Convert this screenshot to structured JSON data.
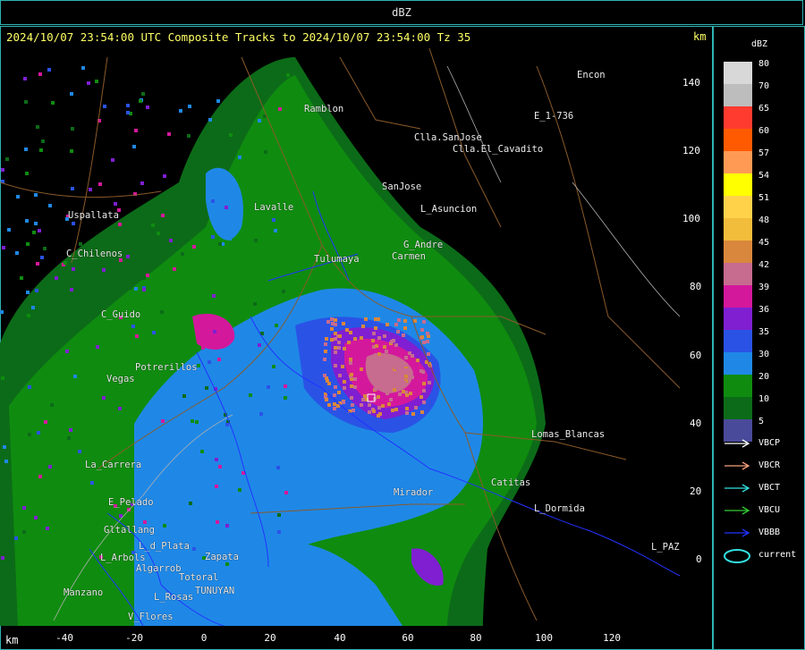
{
  "window": {
    "title": "dBZ"
  },
  "header": {
    "text": "2024/10/07 23:54:00 UTC Composite Tracks to 2024/10/07 23:54:00 Tz 35",
    "km_label": "km"
  },
  "axes": {
    "x_unit": "km",
    "x_ticks": [
      "-40",
      "-20",
      "0",
      "20",
      "40",
      "60",
      "80",
      "100",
      "120"
    ],
    "y_ticks": [
      "140",
      "120",
      "100",
      "80",
      "60",
      "40",
      "20",
      "0"
    ]
  },
  "legend": {
    "title": "dBZ",
    "levels": [
      {
        "label": "80",
        "color": "#d8d8d8"
      },
      {
        "label": "70",
        "color": "#bdbdbd"
      },
      {
        "label": "65",
        "color": "#ff3b2f"
      },
      {
        "label": "60",
        "color": "#ff5a00"
      },
      {
        "label": "57",
        "color": "#ff9a55"
      },
      {
        "label": "54",
        "color": "#ffff00"
      },
      {
        "label": "51",
        "color": "#ffd24a"
      },
      {
        "label": "48",
        "color": "#f2bd3a"
      },
      {
        "label": "45",
        "color": "#d9873c"
      },
      {
        "label": "42",
        "color": "#c76b8f"
      },
      {
        "label": "39",
        "color": "#d4189c"
      },
      {
        "label": "36",
        "color": "#7f1fd1"
      },
      {
        "label": "35",
        "color": "#2a53e6"
      },
      {
        "label": "30",
        "color": "#1f88e6"
      },
      {
        "label": "20",
        "color": "#0f8c0f"
      },
      {
        "label": "10",
        "color": "#0c6b18"
      },
      {
        "label": "5",
        "color": "#4a4a9a"
      }
    ],
    "tracks": [
      {
        "label": "VBCP",
        "color": "#ffffff"
      },
      {
        "label": "VBCR",
        "color": "#f5a07a"
      },
      {
        "label": "VBCT",
        "color": "#33e0e0"
      },
      {
        "label": "VBCU",
        "color": "#33cc33"
      },
      {
        "label": "VBBB",
        "color": "#2233ff"
      }
    ],
    "current": {
      "label": "current",
      "color": "#33e0e0"
    }
  },
  "places": [
    "Ramblon",
    "Encon",
    "E_1-736",
    "Clla.SanJose",
    "Clla.El_Cavadito",
    "SanJose",
    "L_Asuncion",
    "Uspallata",
    "C_Chilenos",
    "Lavalle",
    "Tulumaya",
    "G_Andre",
    "Carmen",
    "C_Guido",
    "Potrerillos",
    "Vegas",
    "Lomas_Blancas",
    "La_Carrera",
    "Catitas",
    "L_Dormida",
    "L_PAZ",
    "Mirador",
    "Gltallang",
    "L_d_Plata",
    "L_Arbols",
    "Algarrob",
    "Zapata",
    "Manzano",
    "TUNUYAN",
    "V_Flores",
    "L_Rosas",
    "Totoral",
    "E_Pelado"
  ],
  "map_style": {
    "background": "#000000",
    "border_color": "#2fb3b3",
    "boundary_color": "#8a5a2a",
    "road_color": "#2233ff",
    "river_color": "#b0b0b0"
  }
}
